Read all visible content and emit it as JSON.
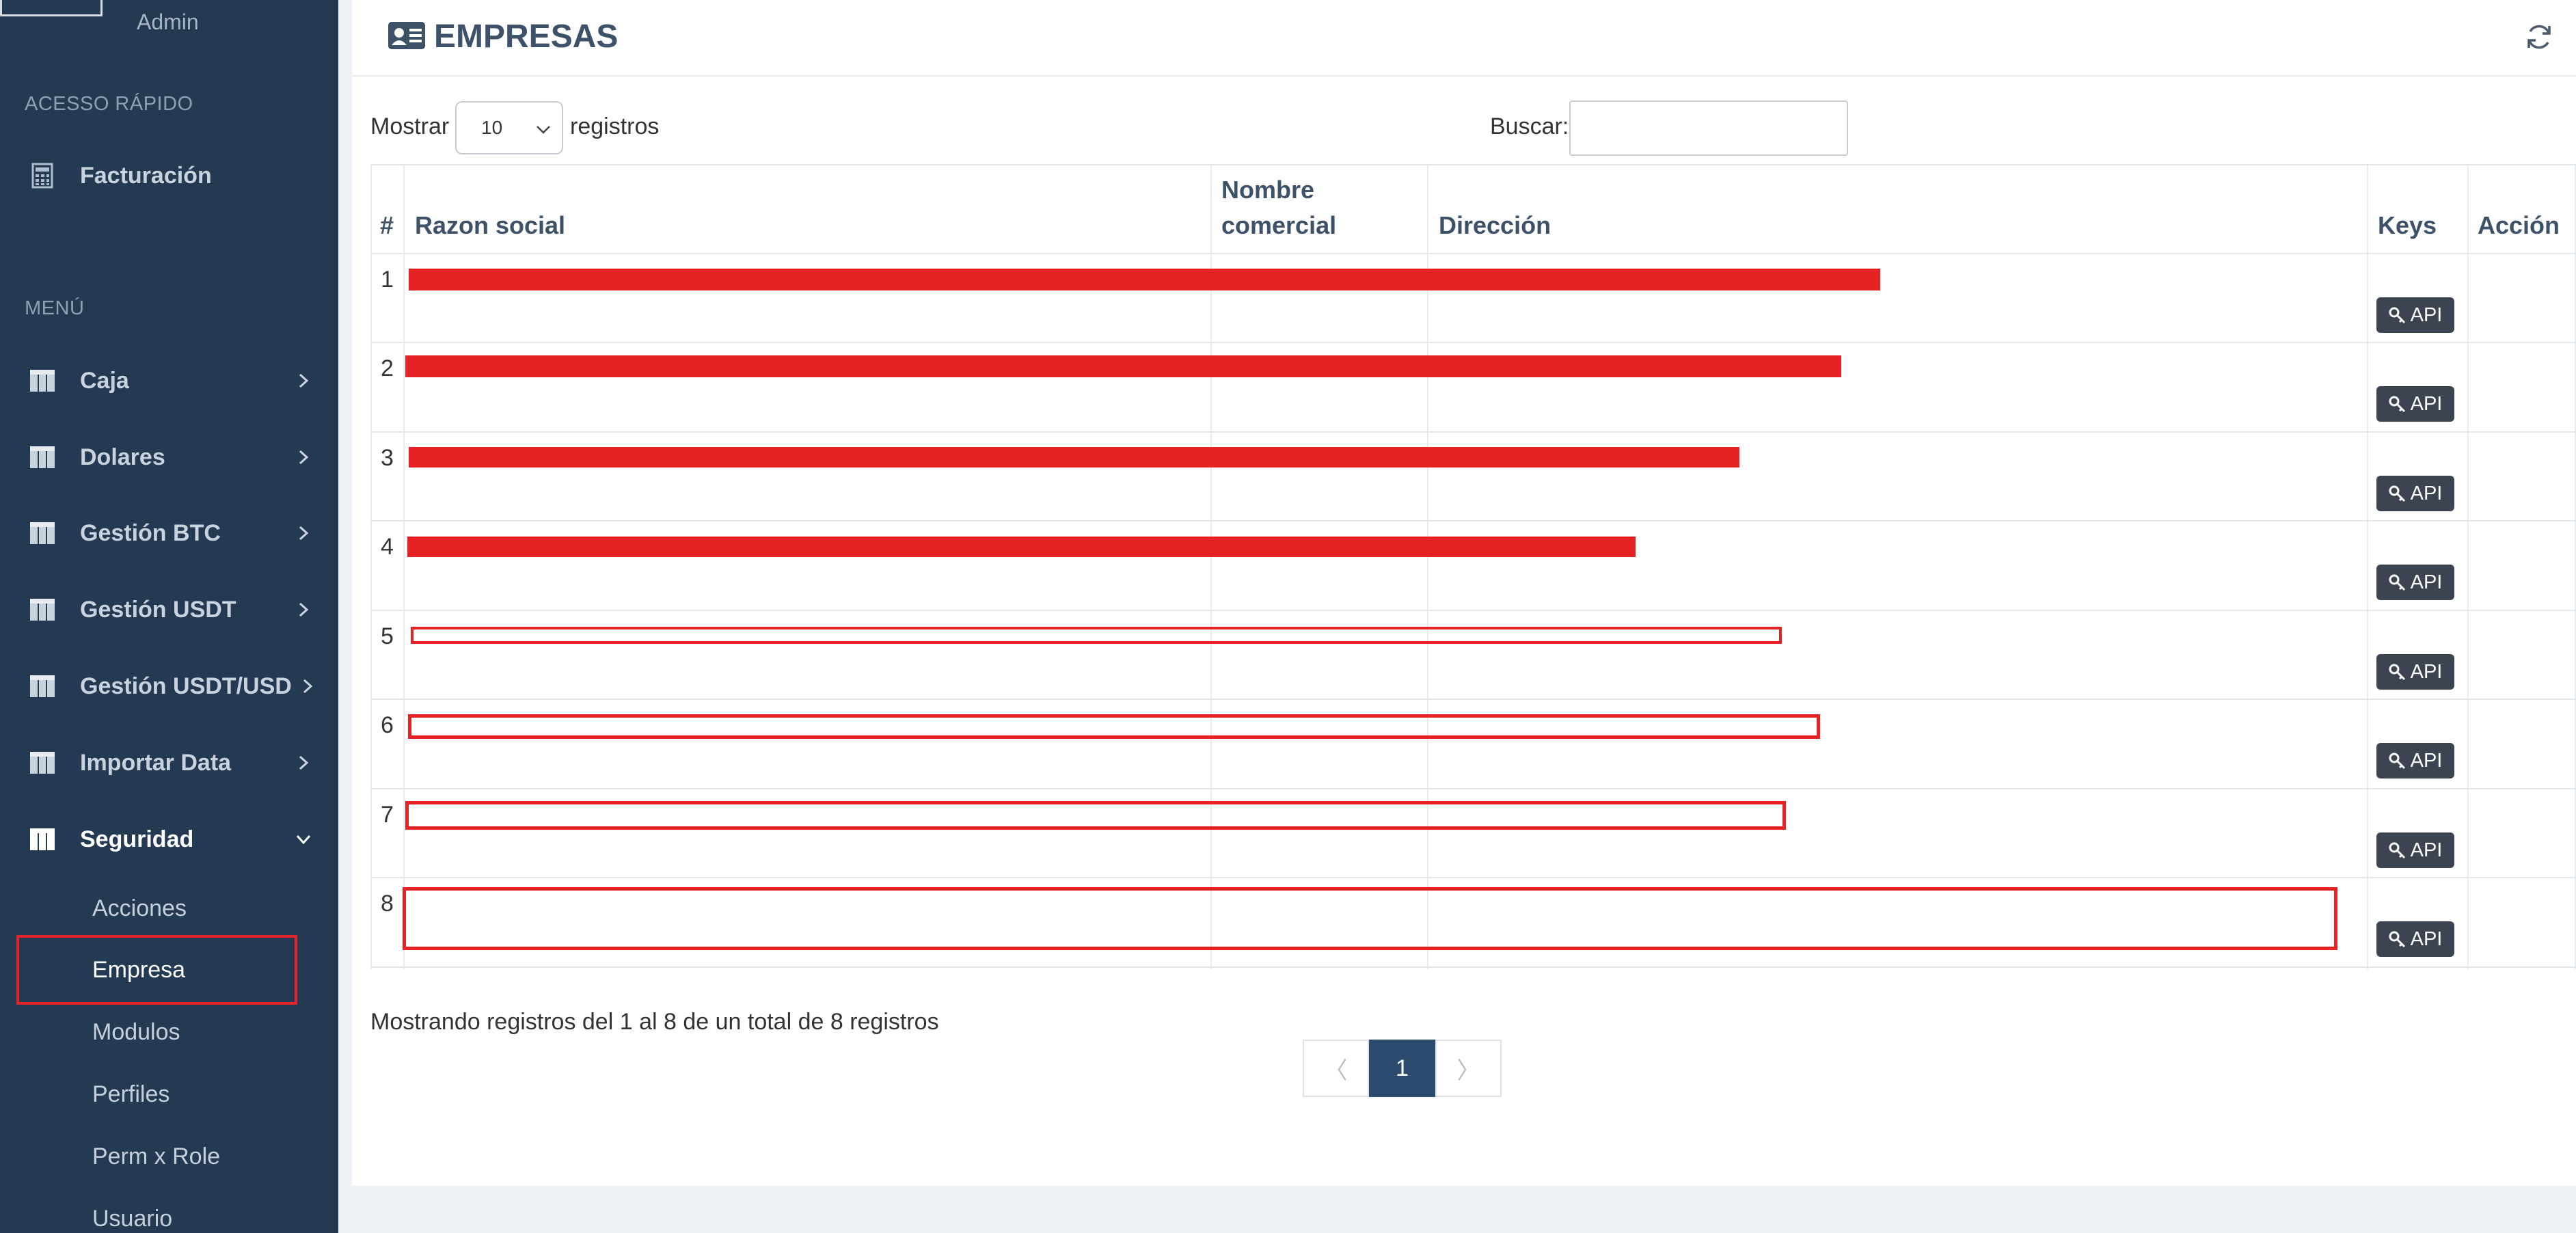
{
  "sidebar": {
    "user_role": "Admin",
    "quick_access_header": "ACESSO RÁPIDO",
    "quick_access_item": "Facturación",
    "menu_header": "MENÚ",
    "items": [
      {
        "label": "Caja"
      },
      {
        "label": "Dolares"
      },
      {
        "label": "Gestión BTC"
      },
      {
        "label": "Gestión USDT"
      },
      {
        "label": "Gestión USDT/USD"
      },
      {
        "label": "Importar Data"
      },
      {
        "label": "Seguridad"
      }
    ],
    "security_subitems": [
      {
        "label": "Acciones"
      },
      {
        "label": "Empresa"
      },
      {
        "label": "Modulos"
      },
      {
        "label": "Perfiles"
      },
      {
        "label": "Perm x Role"
      },
      {
        "label": "Usuario"
      }
    ]
  },
  "page": {
    "title": "EMPRESAS"
  },
  "controls": {
    "show_label": "Mostrar",
    "length_value": "10",
    "records_label": "registros",
    "search_label": "Buscar:",
    "search_value": ""
  },
  "table": {
    "columns": {
      "num": "#",
      "razon_social": "Razon social",
      "nombre_comercial_1": "Nombre",
      "nombre_comercial_2": "comercial",
      "direccion": "Dirección",
      "keys": "Keys",
      "accion": "Acción"
    },
    "rows": [
      {
        "num": "1",
        "key_button": "API"
      },
      {
        "num": "2",
        "key_button": "API"
      },
      {
        "num": "3",
        "key_button": "API"
      },
      {
        "num": "4",
        "key_button": "API"
      },
      {
        "num": "5",
        "key_button": "API"
      },
      {
        "num": "6",
        "key_button": "API"
      },
      {
        "num": "7",
        "key_button": "API"
      },
      {
        "num": "8",
        "key_button": "API"
      }
    ]
  },
  "footer": {
    "info": "Mostrando registros del 1 al 8 de un total de 8 registros",
    "prev": "〈",
    "current_page": "1",
    "next": "〉"
  },
  "colors": {
    "sidebar_bg": "#243a52",
    "accent": "#2c4a6e",
    "redaction": "#e62225",
    "api_button": "#3b4450"
  }
}
